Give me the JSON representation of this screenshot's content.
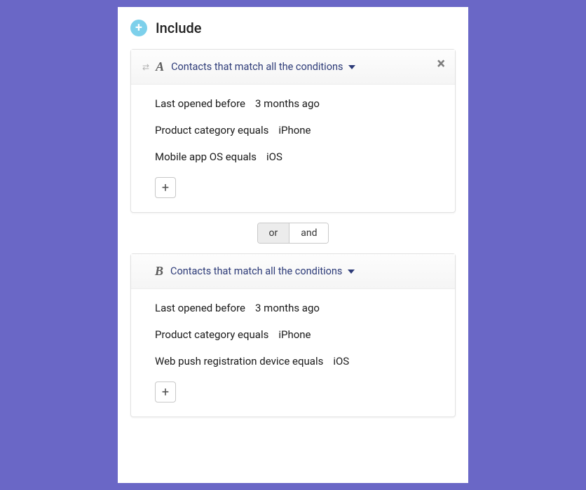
{
  "section": {
    "title": "Include"
  },
  "groups": [
    {
      "letter": "A",
      "dropdown_label": "Contacts that match all the conditions",
      "closable": true,
      "show_drag": true,
      "conditions": [
        {
          "left": "Last opened before",
          "right": "3 months ago"
        },
        {
          "left": "Product category equals",
          "right": "iPhone"
        },
        {
          "left": "Mobile app OS equals",
          "right": "iOS"
        }
      ]
    },
    {
      "letter": "B",
      "dropdown_label": "Contacts that match all the conditions",
      "closable": false,
      "show_drag": false,
      "conditions": [
        {
          "left": "Last opened before",
          "right": "3 months ago"
        },
        {
          "left": "Product category equals",
          "right": "iPhone"
        },
        {
          "left": "Web push registration device equals",
          "right": "iOS"
        }
      ]
    }
  ],
  "join": {
    "options": [
      "or",
      "and"
    ],
    "active": "or"
  },
  "buttons": {
    "add_condition": "+"
  }
}
